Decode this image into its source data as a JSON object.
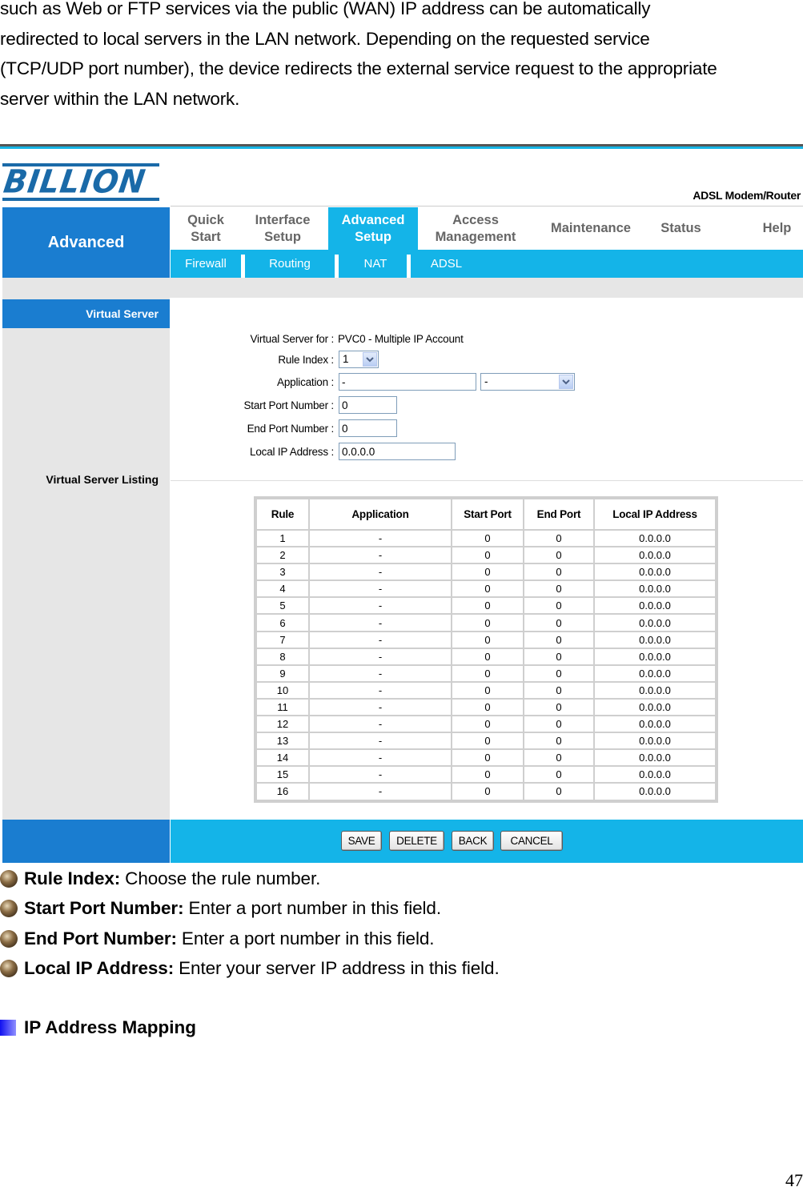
{
  "intro_lines": [
    "such as Web or FTP services via the public (WAN) IP address can be automatically",
    "redirected to local servers in the LAN network. Depending on the requested service",
    "(TCP/UDP port number), the device redirects the external service request to the appropriate",
    "server within the LAN network."
  ],
  "router": {
    "logo": "BILLION",
    "product": "ADSL Modem/Router",
    "section": "Advanced",
    "nav": [
      {
        "label_1": "Quick",
        "label_2": "Start"
      },
      {
        "label_1": "Interface",
        "label_2": "Setup"
      },
      {
        "label_1": "Advanced",
        "label_2": "Setup",
        "active": true
      },
      {
        "label_1": "Access",
        "label_2": "Management"
      },
      {
        "label_1": "Maintenance"
      },
      {
        "label_1": "Status"
      },
      {
        "label_1": "Help"
      }
    ],
    "subnav": [
      "Firewall",
      "Routing",
      "NAT",
      "ADSL"
    ],
    "sidebar": {
      "virtual_server": "Virtual Server",
      "virtual_server_listing": "Virtual Server Listing"
    },
    "form": {
      "virtual_server_for_label": "Virtual Server for :",
      "virtual_server_for_value": "PVC0 - Multiple IP Account",
      "rule_index_label": "Rule Index :",
      "rule_index_value": "1",
      "application_label": "Application :",
      "application_value": "-",
      "application_select": "-",
      "start_port_label": "Start Port Number :",
      "start_port_value": "0",
      "end_port_label": "End Port Number :",
      "end_port_value": "0",
      "local_ip_label": "Local IP Address :",
      "local_ip_value": "0.0.0.0"
    },
    "table": {
      "headers": [
        "Rule",
        "Application",
        "Start Port",
        "End Port",
        "Local IP Address"
      ],
      "rows": [
        [
          "1",
          "-",
          "0",
          "0",
          "0.0.0.0"
        ],
        [
          "2",
          "-",
          "0",
          "0",
          "0.0.0.0"
        ],
        [
          "3",
          "-",
          "0",
          "0",
          "0.0.0.0"
        ],
        [
          "4",
          "-",
          "0",
          "0",
          "0.0.0.0"
        ],
        [
          "5",
          "-",
          "0",
          "0",
          "0.0.0.0"
        ],
        [
          "6",
          "-",
          "0",
          "0",
          "0.0.0.0"
        ],
        [
          "7",
          "-",
          "0",
          "0",
          "0.0.0.0"
        ],
        [
          "8",
          "-",
          "0",
          "0",
          "0.0.0.0"
        ],
        [
          "9",
          "-",
          "0",
          "0",
          "0.0.0.0"
        ],
        [
          "10",
          "-",
          "0",
          "0",
          "0.0.0.0"
        ],
        [
          "11",
          "-",
          "0",
          "0",
          "0.0.0.0"
        ],
        [
          "12",
          "-",
          "0",
          "0",
          "0.0.0.0"
        ],
        [
          "13",
          "-",
          "0",
          "0",
          "0.0.0.0"
        ],
        [
          "14",
          "-",
          "0",
          "0",
          "0.0.0.0"
        ],
        [
          "15",
          "-",
          "0",
          "0",
          "0.0.0.0"
        ],
        [
          "16",
          "-",
          "0",
          "0",
          "0.0.0.0"
        ]
      ]
    },
    "buttons": {
      "save": "SAVE",
      "delete": "DELETE",
      "back": "BACK",
      "cancel": "CANCEL"
    }
  },
  "bullets": [
    {
      "term": "Rule Index:",
      "desc": "Choose the rule number."
    },
    {
      "term": "Start Port Number:",
      "desc": "Enter a port number in this field."
    },
    {
      "term": "End Port Number:",
      "desc": "Enter a port number in this field."
    },
    {
      "term": "Local IP Address:",
      "desc": "Enter your server IP address in this field."
    }
  ],
  "next_heading": "IP Address Mapping",
  "page_number": "47"
}
